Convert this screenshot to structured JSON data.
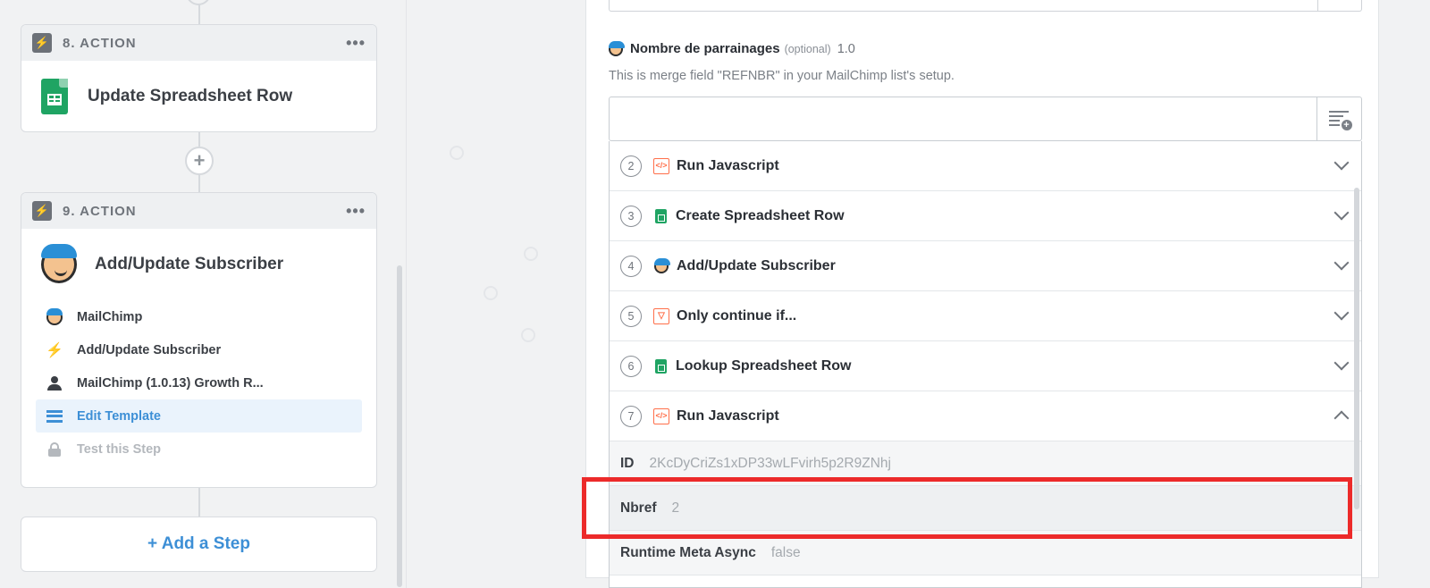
{
  "steps": [
    {
      "number_label": "8. ACTION",
      "menu": "•••",
      "title": "Update Spreadsheet Row"
    },
    {
      "number_label": "9. ACTION",
      "menu": "•••",
      "title": "Add/Update Subscriber",
      "sub_items": [
        {
          "label": "MailChimp",
          "icon": "mailchimp-icon"
        },
        {
          "label": "Add/Update Subscriber",
          "icon": "bolt-icon"
        },
        {
          "label": "MailChimp (1.0.13) Growth R...",
          "icon": "person-icon"
        },
        {
          "label": "Edit Template",
          "icon": "list-icon",
          "state": "active"
        },
        {
          "label": "Test this Step",
          "icon": "lock-icon",
          "state": "disabled"
        }
      ]
    }
  ],
  "add_step_label": "+ Add a Step",
  "plus_glyph": "+",
  "field": {
    "label": "Nombre de parrainages",
    "optional": "(optional)",
    "version": "1.0",
    "help": "This is merge field \"REFNBR\" in your MailChimp list's setup."
  },
  "dropdown": {
    "rows": [
      {
        "num": "2",
        "icon": "code-icon",
        "label": "Run Javascript"
      },
      {
        "num": "3",
        "icon": "sheets-icon",
        "label": "Create Spreadsheet Row"
      },
      {
        "num": "4",
        "icon": "mailchimp-icon",
        "label": "Add/Update Subscriber"
      },
      {
        "num": "5",
        "icon": "filter-icon",
        "label": "Only continue if..."
      },
      {
        "num": "6",
        "icon": "sheets-icon",
        "label": "Lookup Spreadsheet Row"
      },
      {
        "num": "7",
        "icon": "code-icon",
        "label": "Run Javascript",
        "expanded": true
      }
    ],
    "fields": [
      {
        "key": "ID",
        "value": "2KcDyCriZs1xDP33wLFvirh5p2R9ZNhj"
      },
      {
        "key": "Nbref",
        "value": "2"
      },
      {
        "key": "Runtime Meta Async",
        "value": "false"
      }
    ]
  },
  "icon_glyphs": {
    "code": "</>",
    "filter": "▽",
    "bolt": "⚡"
  },
  "colors": {
    "accent": "#3d8fd6",
    "highlight": "#ec2a2a",
    "sheets": "#1fa463",
    "code": "#ff6f4a"
  }
}
